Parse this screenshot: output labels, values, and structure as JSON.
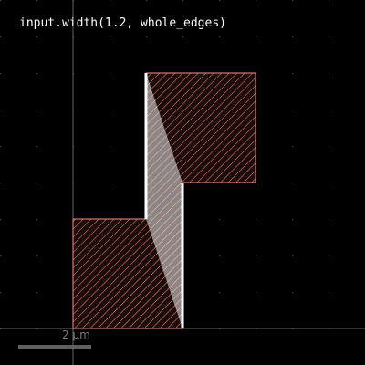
{
  "title": "input.width(1.2, whole_edges)",
  "scale_bar": {
    "label": "2 µm",
    "length_um": 2
  },
  "units": "µm",
  "grid": {
    "pitch_um": 1,
    "color": "#555555"
  },
  "colors": {
    "background": "#000000",
    "text": "#ffffff",
    "shape_outline": "#ff8a80",
    "shape_hatch": "#ff8a80",
    "shape_fill": "#1c0c0a",
    "marker_fill": "#ffffff",
    "marker_fill_opacity": 0.5,
    "edge_highlight": "#ffffff",
    "axis": "#666666",
    "scale_bar": "#606060"
  },
  "geometry_um": {
    "input_polygon": [
      [
        0,
        0
      ],
      [
        3,
        0
      ],
      [
        3,
        4
      ],
      [
        5,
        4
      ],
      [
        5,
        7
      ],
      [
        2,
        7
      ],
      [
        2,
        3
      ],
      [
        0,
        3
      ]
    ],
    "violation_marker": [
      [
        2,
        3
      ],
      [
        2,
        7
      ],
      [
        3,
        4
      ],
      [
        3,
        0
      ]
    ],
    "flagged_edges": [
      [
        [
          2,
          3
        ],
        [
          2,
          7
        ]
      ],
      [
        [
          3,
          0
        ],
        [
          3,
          4
        ]
      ]
    ]
  }
}
